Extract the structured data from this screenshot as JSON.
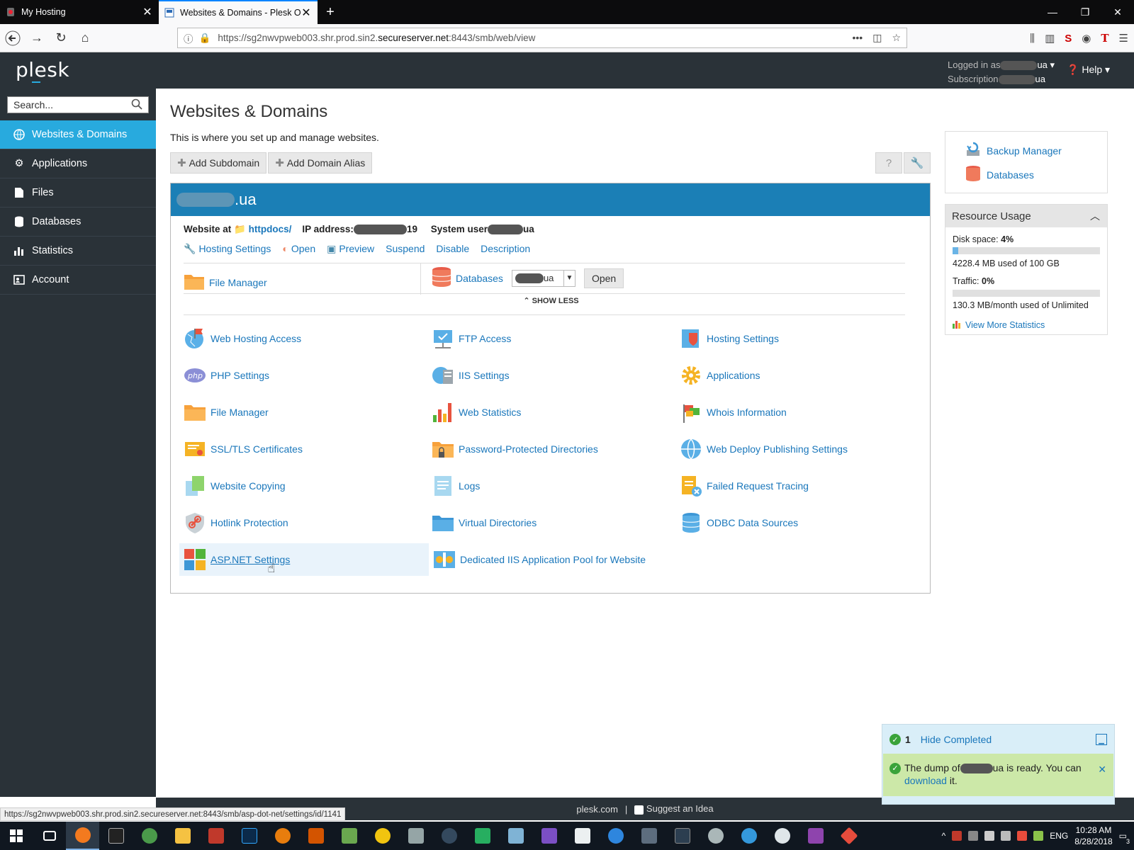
{
  "browser": {
    "tabs": [
      {
        "title": "My Hosting",
        "active": false
      },
      {
        "title": "Websites & Domains - Plesk Or",
        "active": true
      }
    ],
    "url_prefix": "https://sg2nwvpweb003.shr.prod.sin2.",
    "url_domain": "secureserver.net",
    "url_suffix": ":8443/smb/web/view",
    "status_url": "https://sg2nwvpweb003.shr.prod.sin2.secureserver.net:8443/smb/asp-dot-net/settings/id/1141"
  },
  "header": {
    "logo": "plesk",
    "logged_in_label": "Logged in as",
    "logged_in_value": "ua",
    "subscription_label": "Subscription",
    "subscription_value": "ua",
    "help_label": "Help"
  },
  "sidebar": {
    "search_placeholder": "Search...",
    "items": [
      {
        "label": "Websites & Domains",
        "icon": "globe-icon",
        "active": true
      },
      {
        "label": "Applications",
        "icon": "gear-icon",
        "active": false
      },
      {
        "label": "Files",
        "icon": "file-icon",
        "active": false
      },
      {
        "label": "Databases",
        "icon": "database-icon",
        "active": false
      },
      {
        "label": "Statistics",
        "icon": "bar-chart-icon",
        "active": false
      },
      {
        "label": "Account",
        "icon": "id-card-icon",
        "active": false
      }
    ]
  },
  "main": {
    "title": "Websites & Domains",
    "description": "This is where you set up and manage websites.",
    "add_subdomain": "Add Subdomain",
    "add_domain_alias": "Add Domain Alias",
    "domain": {
      "name_suffix": ".ua",
      "website_at_label": "Website at",
      "website_at_link": "httpdocs/",
      "ip_label": "IP address:",
      "ip_suffix": "19",
      "system_user_label": "System user",
      "system_user_suffix": "ua",
      "links": [
        "Hosting Settings",
        "Open",
        "Preview",
        "Suspend",
        "Disable",
        "Description"
      ],
      "file_manager": "File Manager",
      "databases": "Databases",
      "db_select_suffix": "ua",
      "open_btn": "Open",
      "show_less": "SHOW LESS"
    },
    "tools": [
      [
        "Web Hosting Access",
        "FTP Access",
        "Hosting Settings"
      ],
      [
        "PHP Settings",
        "IIS Settings",
        "Applications"
      ],
      [
        "File Manager",
        "Web Statistics",
        "Whois Information"
      ],
      [
        "SSL/TLS Certificates",
        "Password-Protected Directories",
        "Web Deploy Publishing Settings"
      ],
      [
        "Website Copying",
        "Logs",
        "Failed Request Tracing"
      ],
      [
        "Hotlink Protection",
        "Virtual Directories",
        "ODBC Data Sources"
      ],
      [
        "ASP.NET Settings",
        "Dedicated IIS Application Pool for Website",
        ""
      ]
    ]
  },
  "right": {
    "backup_manager": "Backup Manager",
    "databases": "Databases",
    "resource_title": "Resource Usage",
    "disk_label": "Disk space:",
    "disk_value": "4%",
    "disk_fraction": 0.04,
    "disk_detail": "4228.4 MB used of 100 GB",
    "traffic_label": "Traffic:",
    "traffic_value": "0%",
    "traffic_fraction": 0.0,
    "traffic_detail": "130.3 MB/month used of Unlimited",
    "more_stats": "View More Statistics"
  },
  "footer": {
    "site": "plesk.com",
    "divider": "|",
    "suggest": "Suggest an Idea"
  },
  "notification": {
    "count": "1",
    "hide_completed": "Hide Completed",
    "msg_prefix": "The dump of",
    "msg_middle": "ua is ready. You can",
    "link": "download",
    "msg_end": "it."
  },
  "taskbar": {
    "lang": "ENG",
    "time": "10:28 AM",
    "date": "8/28/2018",
    "notif_count": "3"
  },
  "colors": {
    "accent": "#28aade",
    "header_bg": "#2a3238",
    "domain_bar": "#1b7fb6",
    "link": "#1a77bb"
  }
}
